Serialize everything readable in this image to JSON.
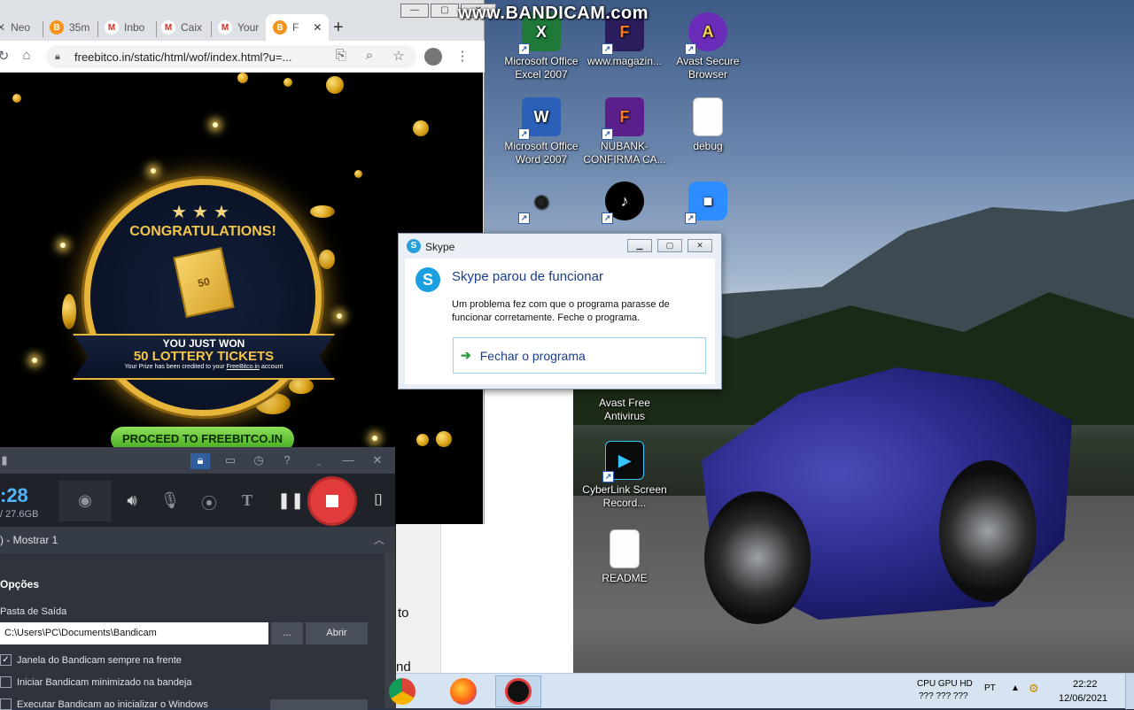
{
  "watermark": "www.BANDICAM.com",
  "chrome": {
    "tabs": [
      {
        "label": "Neo",
        "fav": "B",
        "color": "#f7931a"
      },
      {
        "label": "35m",
        "fav": "B",
        "color": "#f7931a"
      },
      {
        "label": "Inbo",
        "fav": "M",
        "color": "#d93025"
      },
      {
        "label": "Caix",
        "fav": "M",
        "color": "#d93025"
      },
      {
        "label": "Your",
        "fav": "M",
        "color": "#d93025"
      },
      {
        "label": "F",
        "fav": "B",
        "color": "#f7931a"
      }
    ],
    "new_tab": "+",
    "url": "freebitco.in/static/html/wof/index.html?u=..."
  },
  "prize": {
    "title": "CONGRATULATIONS!",
    "stars": "★★★",
    "ticket_number": "50",
    "line1": "YOU JUST WON",
    "line2": "50 LOTTERY TICKETS",
    "line3_pre": "Your Prize has been credited to your ",
    "line3_link": "FreeBitco.in",
    "line3_post": " account",
    "proceed": "PROCEED TO FREEBITCO.IN"
  },
  "bandicam": {
    "timer": ":28",
    "size": "/ 27.6GB",
    "target": ") - Mostrar 1",
    "options_heading": "Opções",
    "output_label": "Pasta de Saída",
    "output_path": "C:\\Users\\PC\\Documents\\Bandicam",
    "browse": "...",
    "open": "Abrir",
    "check1": "Janela do Bandicam sempre na frente",
    "check2": "Iniciar Bandicam minimizado na bandeja",
    "check3": "Executar Bandicam ao inicializar o Windows"
  },
  "desktop": {
    "icons": [
      {
        "label": "Microsoft Office Excel 2007",
        "glyph": "X",
        "color": "#1f7a3a"
      },
      {
        "label": "www.magazin...",
        "glyph": "F",
        "color": "#e66000"
      },
      {
        "label": "Avast Secure Browser",
        "glyph": "A",
        "color": "#6a2bb8"
      },
      {
        "label": "Microsoft Office Word 2007",
        "glyph": "W",
        "color": "#2b5fb8"
      },
      {
        "label": "NUBANK- CONFIRMA CA...",
        "glyph": "F",
        "color": "#6a2bb8"
      },
      {
        "label": "debug",
        "glyph": "",
        "color": "#ffffff"
      },
      {
        "label": "Avast Free Antivirus",
        "glyph": "",
        "color": "#e66000"
      },
      {
        "label": "CyberLink Screen Record...",
        "glyph": "▶",
        "color": "#0b0b0b"
      },
      {
        "label": "README",
        "glyph": "",
        "color": "#ffffff"
      }
    ],
    "fragments": [
      "to",
      "nd"
    ]
  },
  "skype": {
    "title": "Skype",
    "heading": "Skype parou de funcionar",
    "message": "Um problema fez com que o programa parasse de funcionar corretamente. Feche o programa.",
    "action": "Fechar o programa"
  },
  "taskbar": {
    "tray_lang": "PT",
    "cpu_label": "CPU GPU HD",
    "cpu_values": "???   ???  ???",
    "time": "22:22",
    "date": "12/06/2021"
  }
}
